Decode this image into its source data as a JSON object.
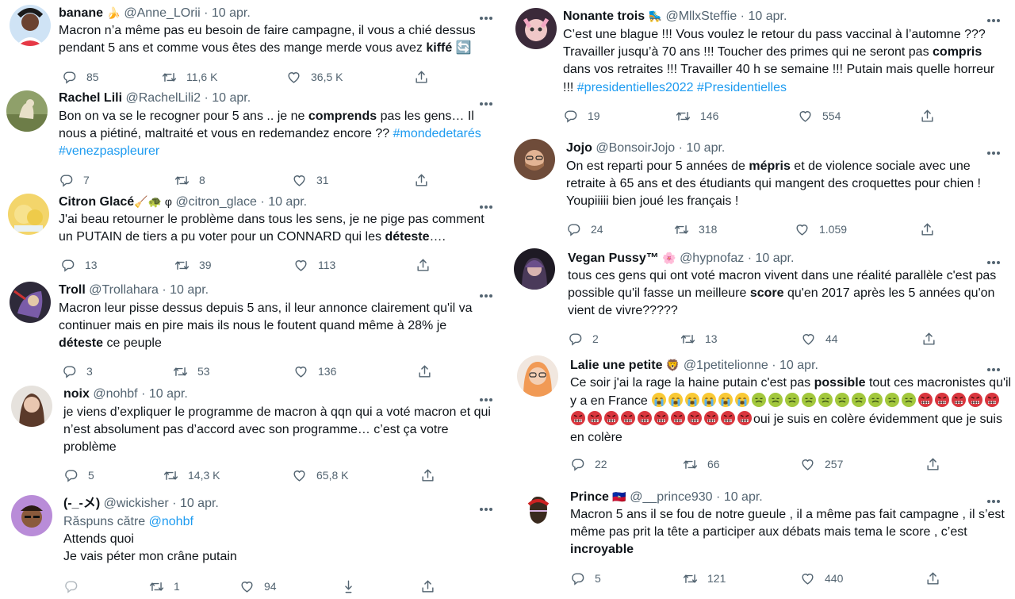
{
  "left_tweets": [
    {
      "name": "banane",
      "name_emoji": "🍌",
      "handle": "@Anne_LOrii",
      "date": "10 apr.",
      "text_segments": [
        "Macron n’a même pas eu besoin de faire campagne, il vous a chié dessus pendant 5 ans et comme vous êtes des mange merde vous avez ",
        "kiffé",
        " 🔄"
      ],
      "replies": "85",
      "retweets": "11,6 K",
      "likes": "36,5 K"
    },
    {
      "name": "Rachel Lili",
      "handle": "@RachelLili2",
      "date": "10 apr.",
      "text_segments": [
        "Bon on va se le recogner pour 5 ans .. je ne ",
        "comprends",
        " pas les gens… Il nous a piétiné, maltraité et vous en redemandez encore ?? ",
        "#mondedetarés",
        " ",
        "#venezpaspleurer"
      ],
      "replies": "7",
      "retweets": "8",
      "likes": "31"
    },
    {
      "name": "Citron Glacé",
      "name_emoji": "🧹🐢 φ",
      "handle": "@citron_glace",
      "date": "10 apr.",
      "text_segments": [
        "J'ai beau retourner le problème dans tous les sens, je ne pige pas comment un PUTAIN de tiers a pu voter pour un CONNARD qui les ",
        "déteste",
        "…."
      ],
      "replies": "13",
      "retweets": "39",
      "likes": "113"
    },
    {
      "name": "Troll",
      "handle": "@Trollahara",
      "date": "10 apr.",
      "text_segments": [
        "Macron leur pisse dessus depuis 5 ans, il leur annonce clairement qu'il va continuer mais en pire mais ils nous le foutent quand même à 28% je ",
        "déteste",
        " ce peuple"
      ],
      "replies": "3",
      "retweets": "53",
      "likes": "136"
    },
    {
      "name": "noix",
      "handle": "@nohbf",
      "date": "10 apr.",
      "text_segments": [
        "je viens d’expliquer le programme de macron à qqn qui a voté macron et qui n’est absolument pas d’accord avec son programme… c’est ça votre problème"
      ],
      "replies": "5",
      "retweets": "14,3 K",
      "likes": "65,8 K"
    },
    {
      "name": "(-_-メ)",
      "handle": "@wickisher",
      "date": "10 apr.",
      "reply_label": "Răspuns către",
      "reply_handle": "@nohbf",
      "line1": "Attends quoi",
      "line2": "Je vais péter mon crâne putain",
      "replies": "",
      "retweets": "1",
      "likes": "94"
    }
  ],
  "right_tweets": [
    {
      "name": "Nonante trois",
      "name_emoji": "🛼",
      "handle": "@MllxSteffie",
      "date": "10 apr.",
      "text_segments": [
        "C’est une blague !!! Vous voulez le retour du pass vaccinal à l’automne ??? Travailler jusqu’à 70 ans !!! Toucher des primes qui ne seront pas ",
        "compris",
        " dans vos retraites !!! Travailler 40 h se semaine !!! Putain mais quelle horreur !!! ",
        "#presidentielles2022",
        " ",
        "#Presidentielles"
      ],
      "replies": "19",
      "retweets": "146",
      "likes": "554"
    },
    {
      "name": "Jojo",
      "handle": "@BonsoirJojo",
      "date": "10 apr.",
      "text_segments": [
        "On est reparti pour 5 années de ",
        "mépris",
        " et de violence sociale avec une retraite à 65 ans et des étudiants qui mangent des croquettes pour chien ! Youpiiiii bien joué les français !"
      ],
      "replies": "24",
      "retweets": "318",
      "likes": "1.059"
    },
    {
      "name": "Vegan Pussy™",
      "name_emoji": "🌸",
      "handle": "@hypnofaz",
      "date": "10 apr.",
      "text_segments": [
        "tous ces gens qui ont voté macron vivent dans une réalité parallèle c'est pas possible qu'il fasse un meilleure ",
        "score",
        " qu'en 2017 après les 5 années qu'on vient de vivre?????"
      ],
      "replies": "2",
      "retweets": "13",
      "likes": "44"
    },
    {
      "name": "Lalie une petite",
      "name_emoji": "🦁",
      "handle": "@1petitelionne",
      "date": "10 apr.",
      "text_start": "Ce soir j'ai la rage la haine putain c'est pas ",
      "text_bold": "possible",
      "text_mid": " tout ces macronistes qu'il y a en France ",
      "text_end": "oui je suis en colère évidemment que je suis en colère",
      "crying_count": 6,
      "sick_count": 10,
      "angry_count": 16,
      "replies": "22",
      "retweets": "66",
      "likes": "257"
    },
    {
      "name": "Prince",
      "name_emoji": "🇭🇹",
      "handle": "@__prince930",
      "date": "10 apr.",
      "text_segments": [
        "Macron  5 ans il se fou de notre gueule , il a même pas fait campagne , il s’est même pas prit la tête a participer aux débats mais tema  le score , c’est ",
        "incroyable"
      ],
      "replies": "5",
      "retweets": "121",
      "likes": "440"
    }
  ],
  "colors": {
    "text": "#0f1419",
    "muted": "#536471",
    "link": "#1d9bf0"
  },
  "icons": [
    "reply-icon",
    "retweet-icon",
    "like-icon",
    "share-icon",
    "more-icon",
    "download-icon"
  ]
}
